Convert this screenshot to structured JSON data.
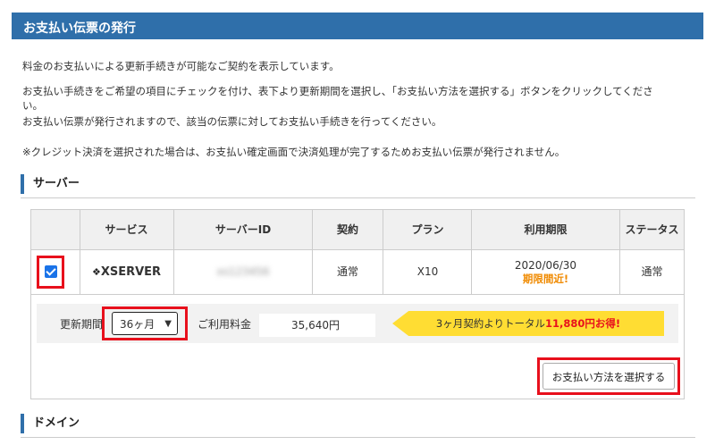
{
  "page": {
    "title": "お支払い伝票の発行",
    "intro_1": "料金のお支払いによる更新手続きが可能なご契約を表示しています。",
    "intro_2a": "お支払い手続きをご希望の項目にチェックを付け、表下より更新期間を選択し、「お支払い方法を選択する」ボタンをクリックしてくださ",
    "intro_2b": "い。",
    "intro_3": "お支払い伝票が発行されますので、該当の伝票に対してお支払い手続きを行ってください。",
    "intro_4": "※クレジット決済を選択された場合は、お支払い確定画面で決済処理が完了するためお支払い伝票が発行されません。"
  },
  "server_section": {
    "heading": "サーバー",
    "columns": [
      "",
      "サービス",
      "サーバーID",
      "契約",
      "プラン",
      "利用期限",
      "ステータス"
    ],
    "rows": [
      {
        "checked": true,
        "service": "XSERVER",
        "service_logo": "xserver-diamond-logo",
        "server_id": "xs123456",
        "contract": "通常",
        "plan": "X10",
        "expiry_date": "2020/06/30",
        "expiry_note": "期限間近!",
        "status": "通常"
      }
    ],
    "renewal": {
      "period_label": "更新期間",
      "period_value": "36ヶ月",
      "fee_label": "ご利用料金",
      "fee_value": "35,640円",
      "promo_text": "3ヶ月契約よりトータル",
      "promo_highlight": "11,880円お得!"
    },
    "submit_label": "お支払い方法を選択する"
  },
  "domain_section": {
    "heading": "ドメイン"
  },
  "colors": {
    "title_bar": "#2f6faa",
    "highlight_border": "#e8101c",
    "warning": "#f08a00",
    "promo_bg": "#ffdd33",
    "checkbox": "#1a73e8"
  }
}
